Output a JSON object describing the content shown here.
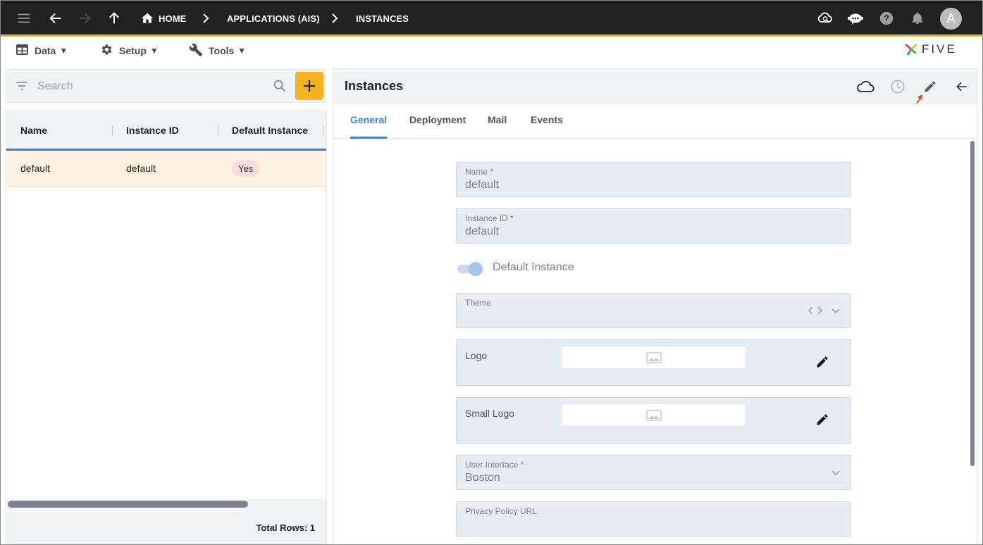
{
  "topbar": {
    "breadcrumbs": [
      "HOME",
      "APPLICATIONS (AIS)",
      "INSTANCES"
    ],
    "avatar_letter": "A",
    "icons": [
      "menu-icon",
      "back-arrow-icon",
      "forward-arrow-icon",
      "up-arrow-icon",
      "home-icon",
      "cloud-sync-icon",
      "chat-bot-icon",
      "help-icon",
      "notifications-icon"
    ],
    "accent_color": "#f5b321"
  },
  "menubar": {
    "items": [
      {
        "label": "Data",
        "icon": "table-icon"
      },
      {
        "label": "Setup",
        "icon": "gear-icon"
      },
      {
        "label": "Tools",
        "icon": "wrench-icon"
      }
    ],
    "logo_text": "FIVE"
  },
  "list": {
    "search_placeholder": "Search",
    "columns": [
      "Name",
      "Instance ID",
      "Default Instance"
    ],
    "rows": [
      {
        "name": "default",
        "instance_id": "default",
        "default_instance": "Yes"
      }
    ],
    "total_rows": "Total Rows: 1"
  },
  "detail": {
    "title": "Instances",
    "tabs": [
      "General",
      "Deployment",
      "Mail",
      "Events"
    ],
    "active_tab": "General",
    "fields": {
      "name": {
        "label": "Name *",
        "value": "default"
      },
      "instance_id": {
        "label": "Instance ID *",
        "value": "default"
      },
      "default_instance": {
        "label": "Default Instance",
        "checked": true
      },
      "theme": {
        "label": "Theme",
        "value": ""
      },
      "logo": {
        "label": "Logo"
      },
      "small_logo": {
        "label": "Small Logo"
      },
      "user_interface": {
        "label": "User Interface *",
        "value": "Boston"
      },
      "privacy_policy_url": {
        "label": "Privacy Policy URL",
        "value": ""
      }
    },
    "colors": {
      "tab_active": "#3c7ecf",
      "field_bg": "#e6edf5",
      "row_highlight": "#fdf3e0"
    }
  }
}
